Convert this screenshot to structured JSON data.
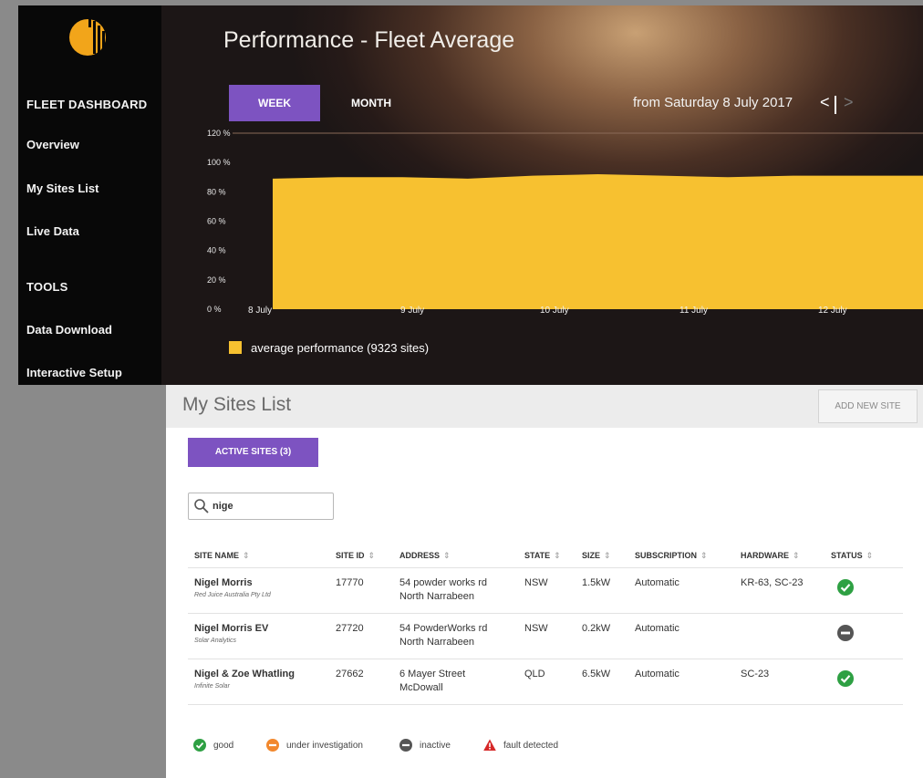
{
  "sidebar": {
    "fleet_heading": "FLEET DASHBOARD",
    "fleet_items": [
      "Overview",
      "My Sites List",
      "Live Data"
    ],
    "tools_heading": "TOOLS",
    "tools_items": [
      "Data Download",
      "Interactive Setup"
    ]
  },
  "hero": {
    "title": "Performance - Fleet Average",
    "tabs": {
      "week": "WEEK",
      "month": "MONTH"
    },
    "date_range": "from Saturday 8 July 2017",
    "nav_prev": "<",
    "nav_next": ">",
    "legend_label": "average performance (9323 sites)"
  },
  "chart_data": {
    "type": "area",
    "x_labels": [
      "8 July",
      "9 July",
      "10 July",
      "11 July",
      "12 July"
    ],
    "y_ticks": [
      "0 %",
      "20 %",
      "40 %",
      "60 %",
      "80 %",
      "100 %",
      "120 %"
    ],
    "ylim": [
      0,
      120
    ],
    "series": [
      {
        "name": "average performance (9323 sites)",
        "color": "#f7c130",
        "values": [
          89,
          90,
          90,
          89,
          91,
          92,
          91,
          90,
          91,
          91,
          91
        ]
      }
    ]
  },
  "sites_panel": {
    "title": "My Sites List",
    "add_button": "ADD NEW SITE",
    "active_tab": "ACTIVE SITES (3)",
    "search_value": "nige",
    "columns": [
      "SITE NAME",
      "SITE ID",
      "ADDRESS",
      "STATE",
      "SIZE",
      "SUBSCRIPTION",
      "HARDWARE",
      "STATUS"
    ],
    "sort_glyph": "⇕",
    "rows": [
      {
        "name": "Nigel Morris",
        "company": "Red Juice Australia Pty Ltd",
        "site_id": "17770",
        "address_1": "54 powder works rd",
        "address_2": "North Narrabeen",
        "state": "NSW",
        "size": "1.5kW",
        "subscription": "Automatic",
        "hardware": "KR-63, SC-23",
        "status": "good"
      },
      {
        "name": "Nigel Morris EV",
        "company": "Solar Analytics",
        "site_id": "27720",
        "address_1": "54 PowderWorks rd",
        "address_2": "North Narrabeen",
        "state": "NSW",
        "size": "0.2kW",
        "subscription": "Automatic",
        "hardware": "",
        "status": "inactive"
      },
      {
        "name": "Nigel & Zoe Whatling",
        "company": "Infinite Solar",
        "site_id": "27662",
        "address_1": "6 Mayer Street",
        "address_2": "McDowall",
        "state": "QLD",
        "size": "6.5kW",
        "subscription": "Automatic",
        "hardware": "SC-23",
        "status": "good"
      }
    ],
    "status_legend": {
      "good": "good",
      "investigation": "under investigation",
      "inactive": "inactive",
      "fault": "fault detected"
    }
  },
  "colors": {
    "accent": "#7d53c1",
    "chart_fill": "#f7c130",
    "status_good": "#2ea043",
    "status_investigation": "#f2882d",
    "status_inactive": "#555555",
    "status_fault": "#d62828"
  }
}
